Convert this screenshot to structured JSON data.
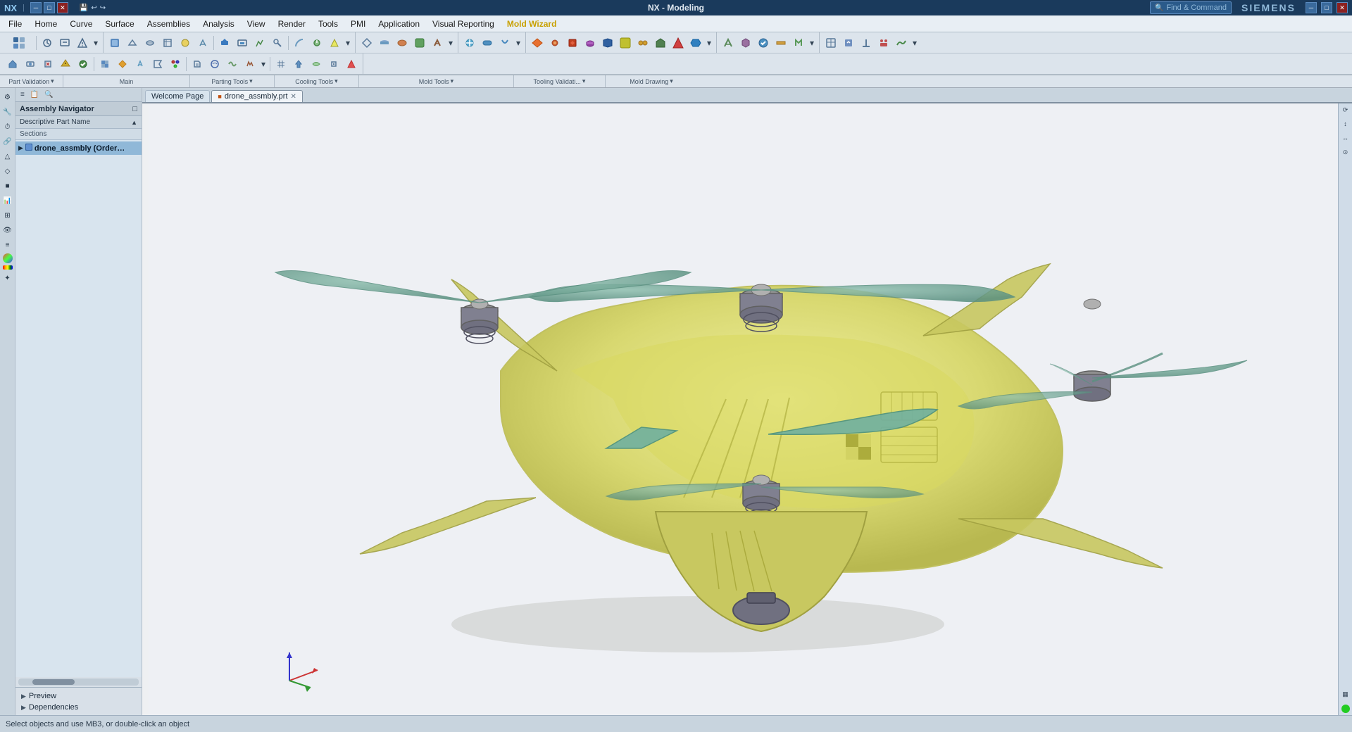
{
  "titleBar": {
    "appName": "NX",
    "title": "NX - Modeling",
    "company": "SIEMENS",
    "findCommand": "Find & Command...",
    "findCommandLabel": "Find & Command"
  },
  "menuBar": {
    "items": [
      {
        "id": "file",
        "label": "File"
      },
      {
        "id": "home",
        "label": "Home"
      },
      {
        "id": "curve",
        "label": "Curve"
      },
      {
        "id": "surface",
        "label": "Surface"
      },
      {
        "id": "assemblies",
        "label": "Assemblies"
      },
      {
        "id": "analysis",
        "label": "Analysis"
      },
      {
        "id": "view",
        "label": "View"
      },
      {
        "id": "render",
        "label": "Render"
      },
      {
        "id": "tools",
        "label": "Tools"
      },
      {
        "id": "pmi",
        "label": "PMI"
      },
      {
        "id": "application",
        "label": "Application"
      },
      {
        "id": "visual-reporting",
        "label": "Visual Reporting"
      },
      {
        "id": "mold-wizard",
        "label": "Mold Wizard"
      }
    ]
  },
  "toolbarGroups": [
    {
      "label": "Part Validation",
      "hasDropdown": true
    },
    {
      "label": "Main",
      "hasDropdown": false
    },
    {
      "label": "Parting Tools",
      "hasDropdown": true
    },
    {
      "label": "Cooling Tools",
      "hasDropdown": true
    },
    {
      "label": "Mold Tools",
      "hasDropdown": true
    },
    {
      "label": "Tooling Validati...",
      "hasDropdown": true
    },
    {
      "label": "Mold Drawing",
      "hasDropdown": true
    }
  ],
  "sidebar": {
    "assemblyNavLabel": "Assembly Navigator",
    "descriptivePartNameLabel": "Descriptive Part Name",
    "sectionsLabel": "Sections",
    "rootNode": "drone_assmbly (Order: Chr",
    "previewLabel": "Preview",
    "dependenciesLabel": "Dependencies"
  },
  "tabs": [
    {
      "id": "welcome",
      "label": "Welcome Page",
      "closable": false,
      "active": false
    },
    {
      "id": "drone",
      "label": "drone_assmbly.prt",
      "closable": true,
      "active": true,
      "modified": true
    }
  ],
  "statusBar": {
    "message": "Select objects and use MB3, or double-click an object"
  },
  "viewport": {
    "hasCoordinates": true
  }
}
